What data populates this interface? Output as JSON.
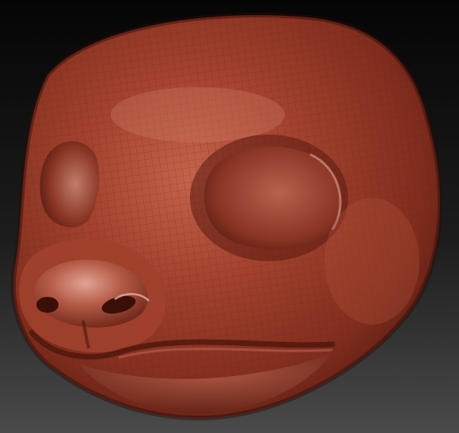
{
  "viewport": {
    "background_top": "#050505",
    "background_bottom": "#4a4a4a"
  },
  "model": {
    "subject": "sculpted-animal-head",
    "material_color": "#9a3a28",
    "highlight_color": "#d48a78",
    "shadow_color": "#3d120b",
    "wireframe_visible": true,
    "wire_color": "#6e2618"
  }
}
